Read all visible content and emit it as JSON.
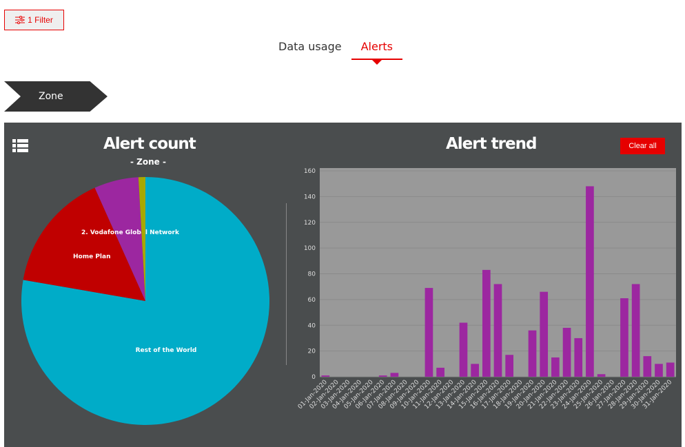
{
  "filter_button": {
    "label": "1 Filter",
    "icon": "sliders-icon"
  },
  "tabs": [
    {
      "label": "Data usage",
      "active": false
    },
    {
      "label": "Alerts",
      "active": true
    }
  ],
  "breadcrumb": {
    "label": "Zone"
  },
  "clear_all": "Clear all",
  "colors": {
    "accent": "#e60000",
    "panel": "#4a4d4e",
    "bar": "#9c27a0"
  },
  "chart_data": [
    {
      "type": "pie",
      "title": "Alert count",
      "subtitle": "- Zone -",
      "slices": [
        {
          "label": "Rest of the World",
          "value": 77.8,
          "color": "#00acc8"
        },
        {
          "label": "Home Plan",
          "value": 15.6,
          "color": "#c00000"
        },
        {
          "label": "2. Vodafone Global Network",
          "value": 5.8,
          "color": "#9c27a0"
        },
        {
          "label": "",
          "value": 0.9,
          "color": "#a8a800"
        }
      ]
    },
    {
      "type": "bar",
      "title": "Alert trend",
      "ylim": [
        0,
        160
      ],
      "yticks": [
        0,
        20,
        40,
        60,
        80,
        100,
        120,
        140,
        160
      ],
      "grid": true,
      "categories": [
        "01-Jan-2020",
        "02-Jan-2020",
        "03-Jan-2020",
        "04-Jan-2020",
        "05-Jan-2020",
        "06-Jan-2020",
        "07-Jan-2020",
        "08-Jan-2020",
        "09-Jan-2020",
        "10-Jan-2020",
        "11-Jan-2020",
        "12-Jan-2020",
        "13-Jan-2020",
        "14-Jan-2020",
        "15-Jan-2020",
        "16-Jan-2020",
        "17-Jan-2020",
        "18-Jan-2020",
        "19-Jan-2020",
        "20-Jan-2020",
        "21-Jan-2020",
        "22-Jan-2020",
        "23-Jan-2020",
        "24-Jan-2020",
        "25-Jan-2020",
        "26-Jan-2020",
        "27-Jan-2020",
        "28-Jan-2020",
        "29-Jan-2020",
        "30-Jan-2020",
        "31-Jan-2020"
      ],
      "values": [
        1,
        0,
        0,
        0,
        0,
        1,
        3,
        0,
        0,
        69,
        7,
        0,
        42,
        10,
        83,
        72,
        17,
        0,
        36,
        66,
        15,
        38,
        30,
        148,
        2,
        0,
        61,
        72,
        16,
        10,
        11
      ]
    }
  ]
}
